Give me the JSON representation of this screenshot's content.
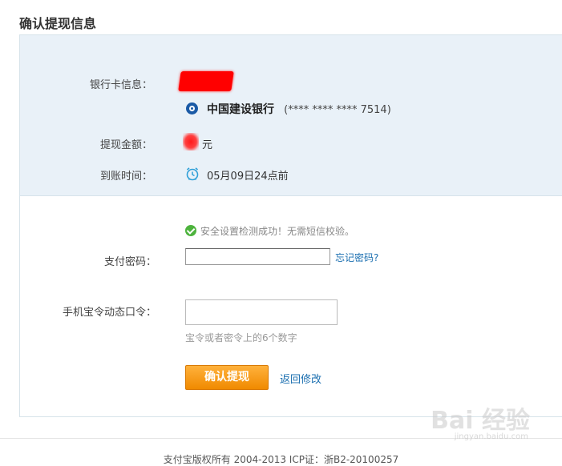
{
  "page": {
    "title": "确认提现信息"
  },
  "info": {
    "card_label": "银行卡信息：",
    "bank_name": "中国建设银行",
    "card_number": "(**** **** **** 7514)",
    "amount_label": "提现金额：",
    "amount_unit": "元",
    "arrival_label": "到账时间：",
    "arrival_time": "05月09日24点前"
  },
  "security": {
    "success_message": "安全设置检测成功！无需短信校验。"
  },
  "password": {
    "label": "支付密码：",
    "value": "",
    "forgot_link": "忘记密码?"
  },
  "token": {
    "label": "手机宝令动态口令：",
    "value": "",
    "hint": "宝令或者密令上的6个数字"
  },
  "actions": {
    "confirm_label": "确认提现",
    "back_label": "返回修改"
  },
  "footer": {
    "copyright": "支付宝版权所有  2004-2013 ICP证：浙B2-20100257"
  },
  "watermark": {
    "brand": "Bai 经验",
    "url": "jingyan.baidu.com"
  },
  "colors": {
    "accent": "#f08a00",
    "link": "#1b6fb0",
    "info_bg": "#e9f1f8",
    "success": "#4db33d",
    "redaction": "#ff0000"
  },
  "icons": {
    "bank": "ccb-logo-icon",
    "clock": "alarm-clock-icon",
    "check": "check-circle-icon"
  }
}
